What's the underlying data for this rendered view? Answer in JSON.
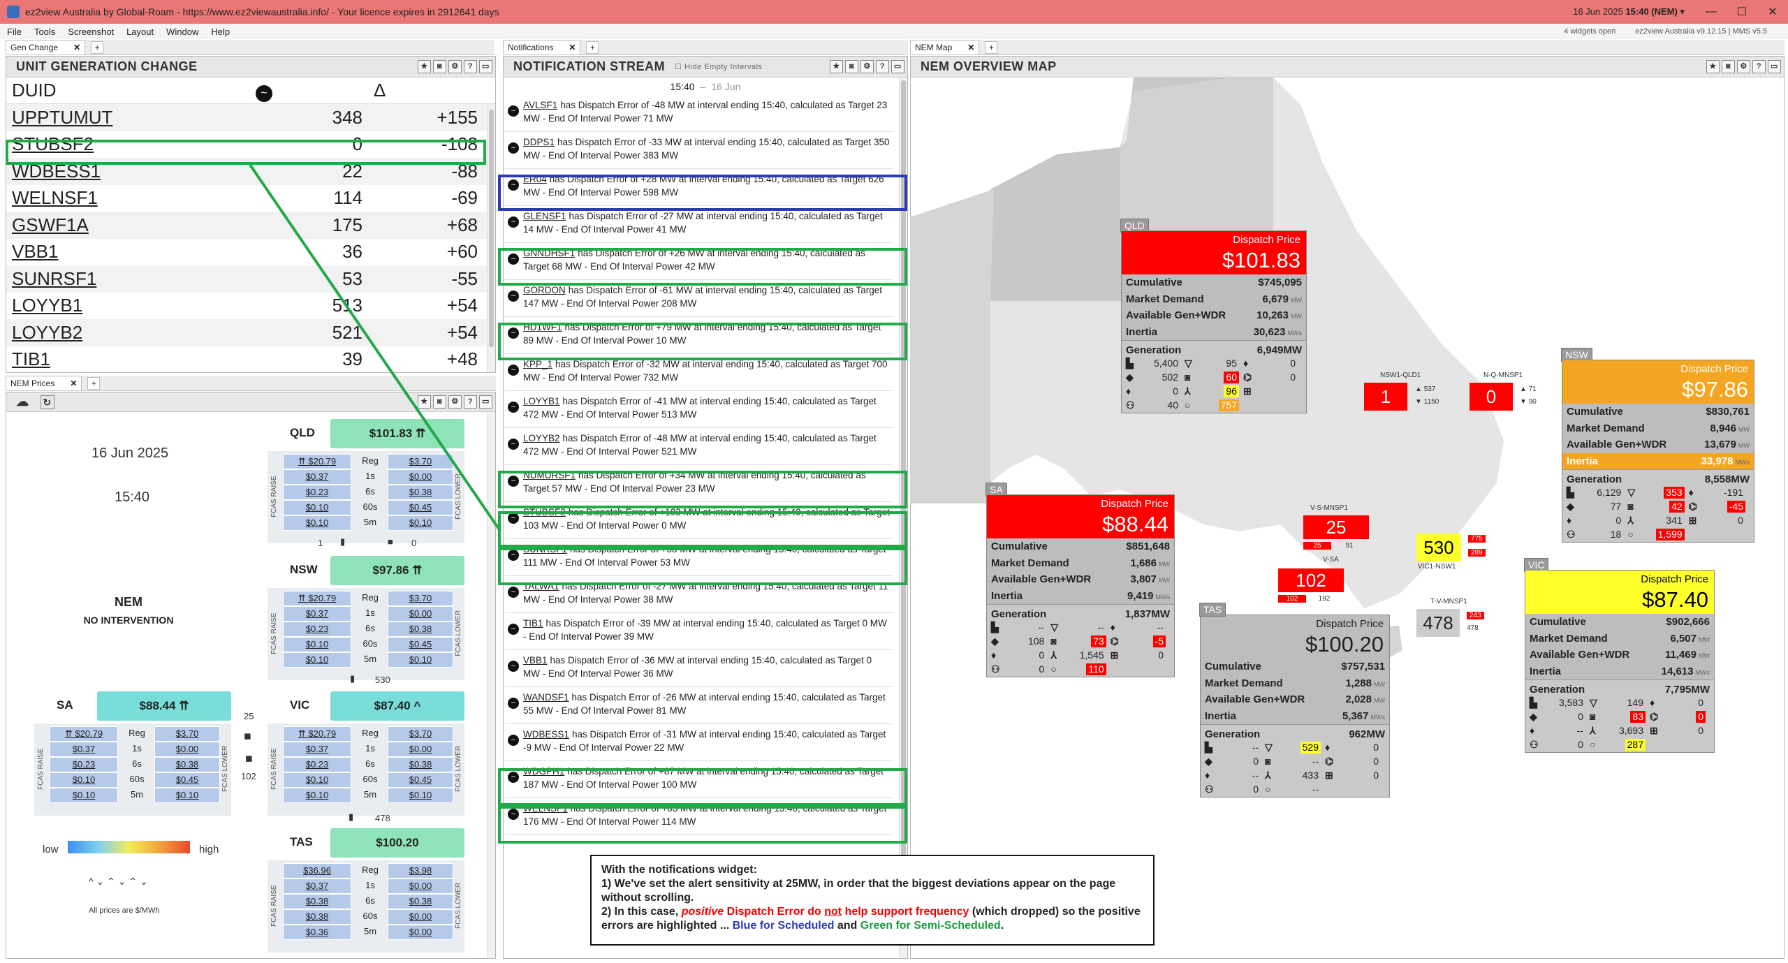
{
  "window": {
    "title": "ez2view Australia by Global-Roam - https://www.ez2viewaustralia.info/ - Your licence expires in 2912641 days",
    "date": "16 Jun 2025",
    "time": "15:40 (NEM)",
    "version": "ez2view Australia v9.12.15 | MMS v5.5",
    "widgets": "4 widgets open"
  },
  "menu": [
    "File",
    "Tools",
    "Screenshot",
    "Layout",
    "Window",
    "Help"
  ],
  "tabs": {
    "gen": "Gen Change",
    "notif": "Notifications",
    "map": "NEM Map",
    "prices": "NEM Prices"
  },
  "ugc": {
    "title": "UNIT GENERATION CHANGE",
    "headers": {
      "duid": "DUID",
      "delta": "Δ"
    },
    "rows": [
      {
        "duid": "UPPTUMUT",
        "val": "348",
        "delta": "+155"
      },
      {
        "duid": "STUBSF2",
        "val": "0",
        "delta": "-108"
      },
      {
        "duid": "WDBESS1",
        "val": "22",
        "delta": "-88"
      },
      {
        "duid": "WELNSF1",
        "val": "114",
        "delta": "-69"
      },
      {
        "duid": "GSWF1A",
        "val": "175",
        "delta": "+68"
      },
      {
        "duid": "VBB1",
        "val": "36",
        "delta": "+60"
      },
      {
        "duid": "SUNRSF1",
        "val": "53",
        "delta": "-55"
      },
      {
        "duid": "LOYYB1",
        "val": "513",
        "delta": "+54"
      },
      {
        "duid": "LOYYB2",
        "val": "521",
        "delta": "+54"
      },
      {
        "duid": "TIB1",
        "val": "39",
        "delta": "+48"
      }
    ]
  },
  "prices": {
    "date": "16 Jun 2025",
    "time": "15:40",
    "nem_title": "NEM",
    "nem_sub": "NO INTERVENTION",
    "legend_low": "low",
    "legend_high": "high",
    "legend_arrows": "^ ⌄ ⌃ ⌄ ⌃ ⌄",
    "footnote": "All prices are $/MWh",
    "mid": [
      "Reg",
      "1s",
      "6s",
      "60s",
      "5m"
    ],
    "fcas_raise": "FCAS RAISE",
    "fcas_lower": "FCAS LOWER",
    "regions": {
      "QLD": {
        "name": "QLD",
        "price": "$101.83 ⇈",
        "raise": [
          "⇈ $20.79",
          "$0.37",
          "$0.23",
          "$0.10",
          "$0.10"
        ],
        "lower": [
          "$3.70",
          "$0.00",
          "$0.38",
          "$0.45",
          "$0.10"
        ]
      },
      "NSW": {
        "name": "NSW",
        "price": "$97.86 ⇈",
        "raise": [
          "⇈ $20.79",
          "$0.37",
          "$0.23",
          "$0.10",
          "$0.10"
        ],
        "lower": [
          "$3.70",
          "$0.00",
          "$0.38",
          "$0.45",
          "$0.10"
        ]
      },
      "SA": {
        "name": "SA",
        "price": "$88.44 ⇈",
        "raise": [
          "⇈ $20.79",
          "$0.37",
          "$0.23",
          "$0.10",
          "$0.10"
        ],
        "lower": [
          "$3.70",
          "$0.00",
          "$0.38",
          "$0.45",
          "$0.10"
        ]
      },
      "VIC": {
        "name": "VIC",
        "price": "$87.40 ^",
        "raise": [
          "⇈ $20.79",
          "$0.37",
          "$0.23",
          "$0.10",
          "$0.10"
        ],
        "lower": [
          "$3.70",
          "$0.00",
          "$0.38",
          "$0.45",
          "$0.10"
        ]
      },
      "TAS": {
        "name": "TAS",
        "price": "$100.20",
        "raise": [
          "$36.96",
          "$0.37",
          "$0.38",
          "$0.38",
          "$0.36"
        ],
        "lower": [
          "$3.98",
          "$0.00",
          "$0.38",
          "$0.00",
          "$0.00"
        ]
      }
    },
    "flows": {
      "qld_nsw_l": "1",
      "qld_nsw_r": "0",
      "nsw_vic": "530",
      "sa_vic_top": "25",
      "sa_vic_bot": "102",
      "vic_tas": "478"
    }
  },
  "notifications": {
    "title": "NOTIFICATION STREAM",
    "hide_label": "Hide Empty Intervals",
    "time": "15:40",
    "date": "16 Jun",
    "items": [
      {
        "duid": "AVLSF1",
        "text": "has Dispatch Error of -48 MW at interval ending 15:40, calculated as Target 23 MW - End Of Interval Power 71 MW"
      },
      {
        "duid": "DDPS1",
        "text": "has Dispatch Error of -33 MW at interval ending 15:40, calculated as Target 350 MW - End Of Interval Power 383 MW"
      },
      {
        "duid": "ER04",
        "text": "has Dispatch Error of +28 MW at interval ending 15:40, calculated as Target 626 MW - End Of Interval Power 598 MW"
      },
      {
        "duid": "GLENSF1",
        "text": "has Dispatch Error of -27 MW at interval ending 15:40, calculated as Target 14 MW - End Of Interval Power 41 MW"
      },
      {
        "duid": "GNNDHSF1",
        "text": "has Dispatch Error of +26 MW at interval ending 15:40, calculated as Target 68 MW - End Of Interval Power 42 MW"
      },
      {
        "duid": "GORDON",
        "text": "has Dispatch Error of -61 MW at interval ending 15:40, calculated as Target 147 MW - End Of Interval Power 208 MW"
      },
      {
        "duid": "HD1WF1",
        "text": "has Dispatch Error of +79 MW at interval ending 15:40, calculated as Target 89 MW - End Of Interval Power 10 MW"
      },
      {
        "duid": "KPP_1",
        "text": "has Dispatch Error of -32 MW at interval ending 15:40, calculated as Target 700 MW - End Of Interval Power 732 MW"
      },
      {
        "duid": "LOYYB1",
        "text": "has Dispatch Error of -41 MW at interval ending 15:40, calculated as Target 472 MW - End Of Interval Power 513 MW"
      },
      {
        "duid": "LOYYB2",
        "text": "has Dispatch Error of -48 MW at interval ending 15:40, calculated as Target 472 MW - End Of Interval Power 521 MW"
      },
      {
        "duid": "NUMURSF1",
        "text": "has Dispatch Error of +34 MW at interval ending 15:40, calculated as Target 57 MW - End Of Interval Power 23 MW"
      },
      {
        "duid": "STUBSF2",
        "text": "has Dispatch Error of +103 MW at interval ending 15:40, calculated as Target 103 MW - End Of Interval Power 0 MW"
      },
      {
        "duid": "SUNRSF1",
        "text": "has Dispatch Error of +58 MW at interval ending 15:40, calculated as Target 111 MW - End Of Interval Power 53 MW"
      },
      {
        "duid": "TALWA1",
        "text": "has Dispatch Error of -27 MW at interval ending 15:40, calculated as Target 11 MW - End Of Interval Power 38 MW"
      },
      {
        "duid": "TIB1",
        "text": "has Dispatch Error of -39 MW at interval ending 15:40, calculated as Target 0 MW - End Of Interval Power 39 MW"
      },
      {
        "duid": "VBB1",
        "text": "has Dispatch Error of -36 MW at interval ending 15:40, calculated as Target 0 MW - End Of Interval Power 36 MW"
      },
      {
        "duid": "WANDSF1",
        "text": "has Dispatch Error of -26 MW at interval ending 15:40, calculated as Target 55 MW - End Of Interval Power 81 MW"
      },
      {
        "duid": "WDBESS1",
        "text": "has Dispatch Error of -31 MW at interval ending 15:40, calculated as Target -9 MW - End Of Interval Power 22 MW"
      },
      {
        "duid": "WDGPH1",
        "text": "has Dispatch Error of +87 MW at interval ending 15:40, calculated as Target 187 MW - End Of Interval Power 100 MW"
      },
      {
        "duid": "WELNSF1",
        "text": "has Dispatch Error of +63 MW at interval ending 15:40, calculated as Target 176 MW - End Of Interval Power 114 MW"
      }
    ]
  },
  "map": {
    "title": "NEM OVERVIEW MAP",
    "dispatch_label": "Dispatch Price",
    "labels": {
      "cum": "Cumulative",
      "dem": "Market Demand",
      "avail": "Available Gen+WDR",
      "inertia": "Inertia",
      "gen": "Generation"
    },
    "units": {
      "mw": "MW",
      "mws": "MWs"
    },
    "QLD": {
      "tag": "QLD",
      "price": "$101.83",
      "cum": "$745,095",
      "dem": "6,679",
      "avail": "10,263",
      "inertia": "30,623",
      "gen": "6,949",
      "g": [
        "5,400",
        "95",
        "0",
        "502",
        "60",
        "0",
        "0",
        "96",
        "",
        "40",
        "757",
        ""
      ]
    },
    "NSW": {
      "tag": "NSW",
      "price": "$97.86",
      "cum": "$830,761",
      "dem": "8,946",
      "avail": "13,679",
      "inertia": "33,978",
      "gen": "8,558",
      "g": [
        "6,129",
        "353",
        "-191",
        "77",
        "42",
        "-45",
        "0",
        "341",
        "0",
        "18",
        "1,599",
        ""
      ]
    },
    "SA": {
      "tag": "SA",
      "price": "$88.44",
      "cum": "$851,648",
      "dem": "1,686",
      "avail": "3,807",
      "inertia": "9,419",
      "gen": "1,837",
      "g": [
        "--",
        "--",
        "--",
        "108",
        "73",
        "-5",
        "0",
        "1,545",
        "0",
        "0",
        "110",
        ""
      ]
    },
    "TAS": {
      "tag": "TAS",
      "price": "$100.20",
      "cum": "$757,531",
      "dem": "1,288",
      "avail": "2,028",
      "inertia": "5,367",
      "gen": "962",
      "g": [
        "--",
        "529",
        "0",
        "0",
        "--",
        "0",
        "--",
        "433",
        "0",
        "0",
        "--",
        ""
      ]
    },
    "VIC": {
      "tag": "VIC",
      "price": "$87.40",
      "cum": "$902,666",
      "dem": "6,507",
      "avail": "11,469",
      "inertia": "14,613",
      "gen": "7,795",
      "g": [
        "3,583",
        "149",
        "0",
        "0",
        "83",
        "0",
        "--",
        "3,693",
        "0",
        "0",
        "287",
        ""
      ]
    },
    "ic": {
      "nsw1qld1": "NSW1-QLD1",
      "nqmnsp1": "N-Q-MNSP1",
      "vsmnsp1": "V-S-MNSP1",
      "vsa": "V-SA",
      "vic1nsw1": "VIC1-NSW1",
      "tvmnsp1": "T-V-MNSP1",
      "nsw1qld1_val": "1",
      "nsw1qld1_a": "537",
      "nsw1qld1_b": "1150",
      "nqmnsp1_val": "0",
      "nqmnsp1_a": "71",
      "nqmnsp1_b": "90",
      "vsmnsp1_val": "25",
      "vsmnsp1_a": "25",
      "vsmnsp1_b": "91",
      "vsa_val": "102",
      "vsa_a": "102",
      "vsa_b": "192",
      "vic1nsw1_val": "530",
      "vic1nsw1_a": "775",
      "vic1nsw1_b": "289",
      "tvmnsp1_val": "478",
      "tvmnsp1_a": "243",
      "tvmnsp1_b": "478"
    }
  },
  "note": {
    "l1": "With the notifications widget:",
    "l2": "1)  We've set the alert sensitivity at 25MW, in order that the biggest deviations appear on the page without scrolling.",
    "l3a": "2)  In this case,",
    "l3b": "positive",
    "l3c": "Dispatch Error do",
    "l3d": "not",
    "l3e": "help support frequency",
    "l3f": "(which dropped) so the positive errors are highlighted ...",
    "l3g": "Blue for Scheduled",
    "l3h": "and",
    "l3i": "Green for Semi-Scheduled",
    "l3j": "."
  },
  "colors": {
    "highlight_green": "#21a94a",
    "highlight_blue": "#2b3bb6",
    "title_bar": "#e87775"
  }
}
